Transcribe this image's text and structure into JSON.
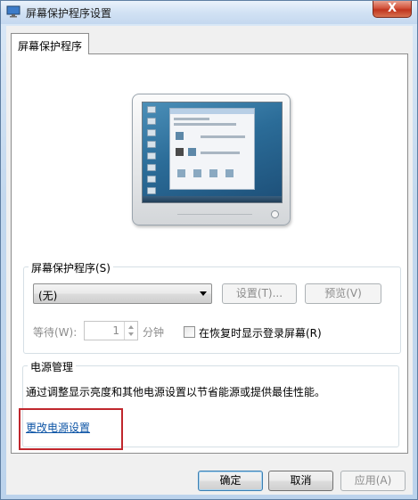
{
  "window": {
    "title": "屏幕保护程序设置",
    "close_label": "X"
  },
  "tab": {
    "label": "屏幕保护程序"
  },
  "screensaver": {
    "group_label": "屏幕保护程序(S)",
    "selected": "(无)",
    "settings_button": "设置(T)...",
    "preview_button": "预览(V)",
    "wait_label": "等待(W):",
    "wait_value": "1",
    "wait_unit": "分钟",
    "resume_logon_label": "在恢复时显示登录屏幕(R)",
    "resume_logon_checked": false
  },
  "power": {
    "group_label": "电源管理",
    "description": "通过调整显示亮度和其他电源设置以节省能源或提供最佳性能。",
    "link": "更改电源设置"
  },
  "footer": {
    "ok_button": "确定",
    "cancel_button": "取消",
    "apply_button": "应用(A)"
  },
  "colors": {
    "link": "#0e55a6",
    "highlight_box": "#c0272d",
    "close_button": "#c0351f"
  }
}
